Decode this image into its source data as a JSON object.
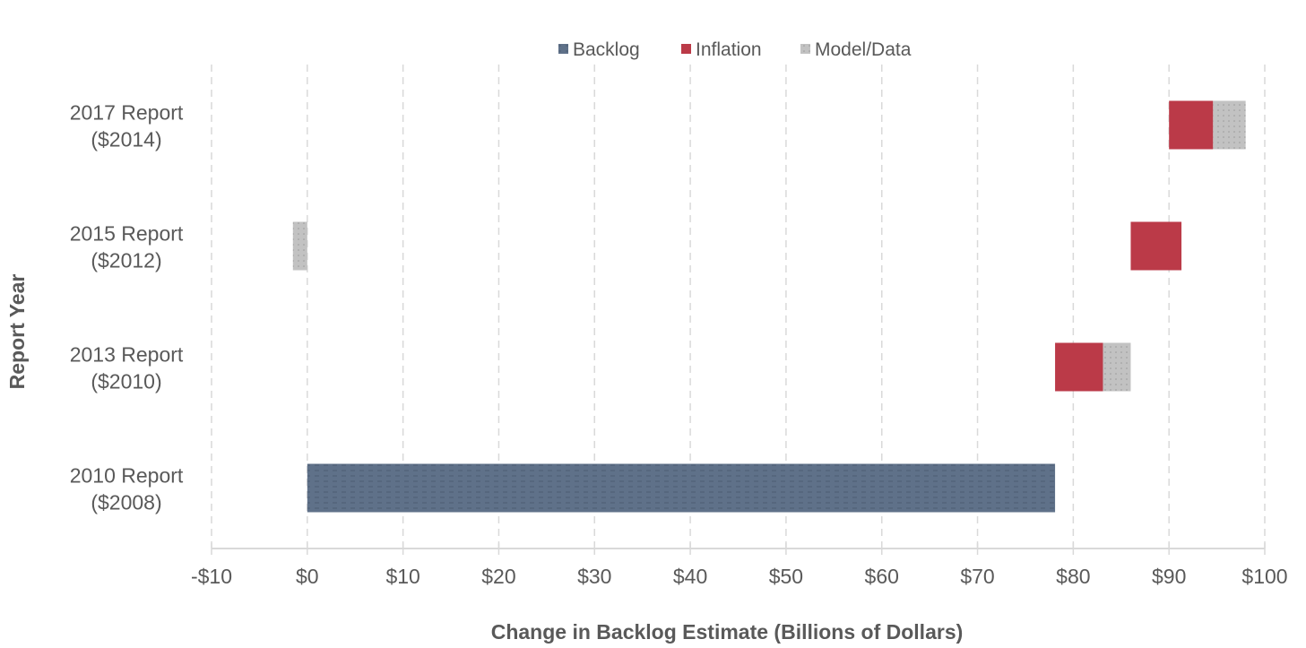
{
  "chart_data": {
    "type": "bar",
    "orientation": "horizontal",
    "stacked": "floating-waterfall",
    "title": "",
    "xlabel": "Change in Backlog Estimate (Billions of Dollars)",
    "ylabel": "Report Year",
    "xlim": [
      -10,
      100
    ],
    "xticks": [
      -10,
      0,
      10,
      20,
      30,
      40,
      50,
      60,
      70,
      80,
      90,
      100
    ],
    "xtick_labels": [
      "-$10",
      "$0",
      "$10",
      "$20",
      "$30",
      "$40",
      "$50",
      "$60",
      "$70",
      "$80",
      "$90",
      "$100"
    ],
    "grid": "vertical dashed",
    "legend_position": "top-center",
    "categories": [
      [
        "2017 Report",
        "($2014)"
      ],
      [
        "2015 Report",
        "($2012)"
      ],
      [
        "2013 Report",
        "($2010)"
      ],
      [
        "2010 Report",
        "($2008)"
      ]
    ],
    "series": [
      {
        "name": "Backlog",
        "color": "#5f7189",
        "segments": [
          null,
          null,
          null,
          {
            "start": 0,
            "end": 78.1,
            "value": 78.1
          }
        ]
      },
      {
        "name": "Inflation",
        "color": "#bb3a48",
        "segments": [
          {
            "start": 90.0,
            "end": 94.6,
            "value": 4.6
          },
          {
            "start": 86.0,
            "end": 91.3,
            "value": 5.3
          },
          {
            "start": 78.1,
            "end": 83.1,
            "value": 5.0
          },
          null
        ]
      },
      {
        "name": "Model/Data",
        "color": "#c0c0c0",
        "segments": [
          {
            "start": 94.6,
            "end": 98.0,
            "value": 3.4
          },
          {
            "start": -1.5,
            "end": 0,
            "value": -1.5
          },
          {
            "start": 83.1,
            "end": 86.0,
            "value": 2.9
          },
          null
        ]
      }
    ]
  }
}
